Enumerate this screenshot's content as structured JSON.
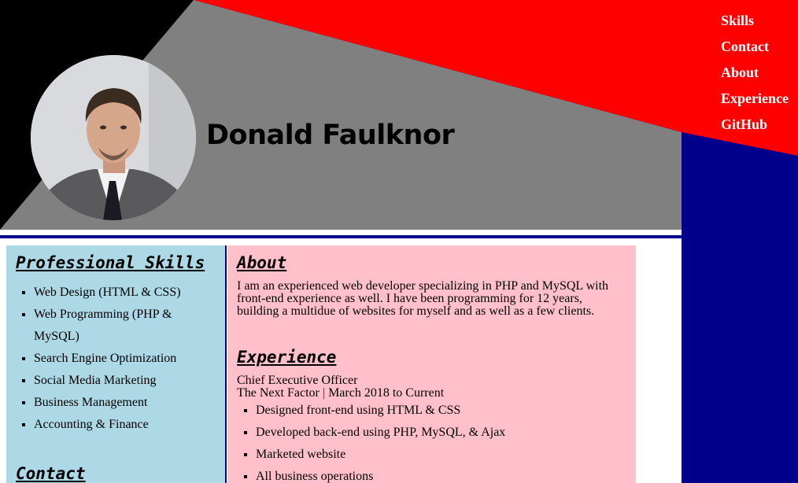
{
  "nav": [
    "Skills",
    "Contact",
    "About",
    "Experience",
    "GitHub"
  ],
  "header": {
    "name": "Donald Faulknor"
  },
  "skills": {
    "heading": "Professional Skills",
    "items": [
      "Web Design (HTML & CSS)",
      "Web Programming (PHP & MySQL)",
      "Search Engine Optimization",
      "Social Media Marketing",
      "Business Management",
      "Accounting & Finance"
    ]
  },
  "contact": {
    "heading": "Contact"
  },
  "about": {
    "heading": "About",
    "text": "I am an experienced web developer specializing in PHP and MySQL with front-end experience as well. I have been programming for 12 years, building a multidue of websites for myself and as well as a few clients."
  },
  "experience": {
    "heading": "Experience",
    "title": "Chief Executive Officer",
    "company": "The Next Factor",
    "separator": "|",
    "dates": "March 2018 to Current",
    "duties": [
      "Designed front-end using HTML & CSS",
      "Developed back-end using PHP, MySQL, & Ajax",
      "Marketed website",
      "All business operations"
    ]
  },
  "colors": {
    "red": "#ff0000",
    "navy": "#00008b",
    "gray": "#808080",
    "lightblue": "#add8e6",
    "pink": "#ffc0cb"
  }
}
